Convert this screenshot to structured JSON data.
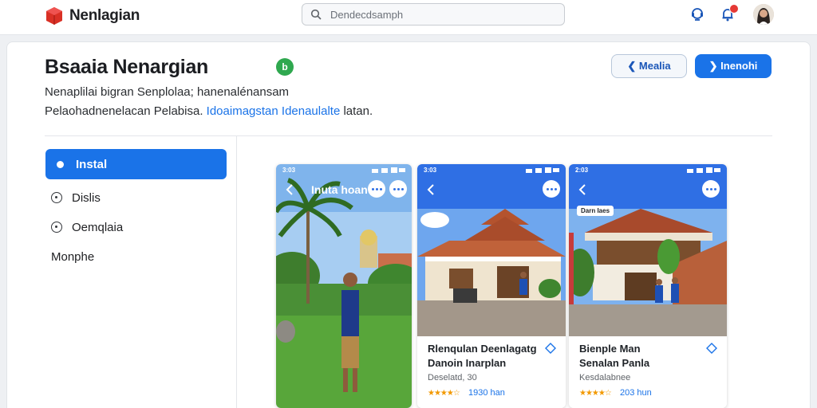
{
  "header": {
    "brand": "Nenlagian",
    "search_placeholder": "Dendecdsamph"
  },
  "page": {
    "title": "Bsaaia Nenargian",
    "badge": "b",
    "desc_line1": "Nenaplilai bigran Senplolaa; hanenalénansam",
    "desc_line2_prefix": "Pelaohadnenelacan Pelabisa.",
    "desc_line2_link": "Idoaimagstan Idenaulalte",
    "desc_line2_suffix": "latan.",
    "btn_back": "Mealia",
    "btn_primary": "Inenohi"
  },
  "sidebar": {
    "items": [
      {
        "label": "Instal",
        "active": true
      },
      {
        "label": "Dislis"
      },
      {
        "label": "Oemqlaia"
      },
      {
        "label": "Monphe"
      }
    ]
  },
  "phones": [
    {
      "time": "3:03",
      "nav_title": "Inuta hoan"
    },
    {
      "time": "3:03",
      "name_line1": "Rlenqulan Deenlagatg",
      "name_line2": "Danoin Inarplan",
      "sub": "Deselatd, 30",
      "stars": "★★★★☆",
      "reviews": "1930 han"
    },
    {
      "time": "2:03",
      "tag": "Darn Iaes",
      "name_line1": "Bienple Man",
      "name_line2": "Senalan Panla",
      "sub": "Kesdalabnee",
      "stars": "★★★★☆",
      "reviews": "203 hun"
    }
  ],
  "colors": {
    "accent": "#1a73e8",
    "badge_green": "#2fa84f",
    "notification": "#e53935"
  }
}
